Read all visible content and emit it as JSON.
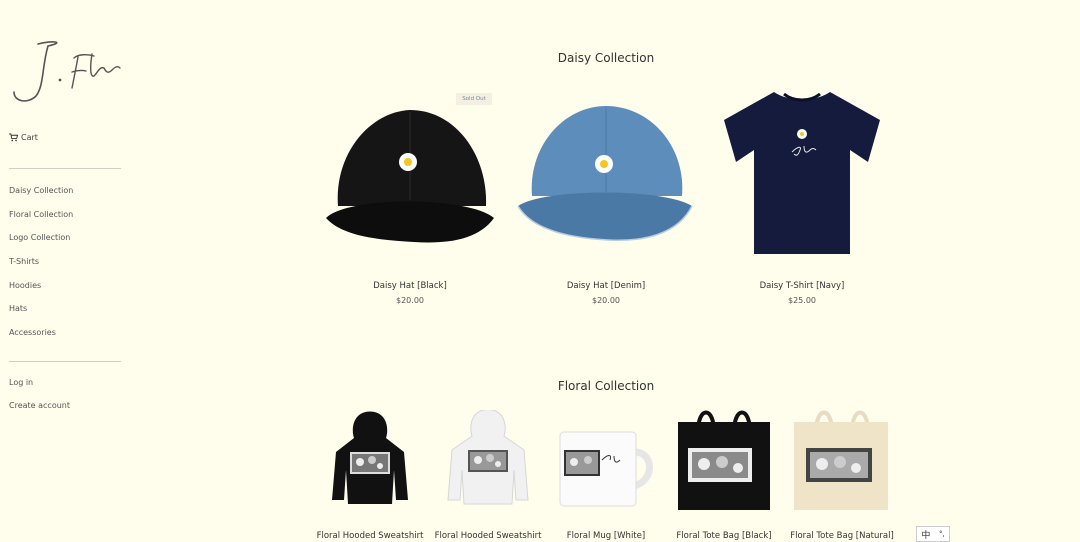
{
  "brand": {
    "logo_text": "J.Flo"
  },
  "sidebar": {
    "cart_label": "Cart",
    "collections": [
      "Daisy Collection",
      "Floral Collection",
      "Logo Collection",
      "T-Shirts",
      "Hoodies",
      "Hats",
      "Accessories"
    ],
    "account": [
      "Log in",
      "Create account"
    ]
  },
  "sections": [
    {
      "title": "Daisy Collection",
      "products": [
        {
          "name": "Daisy Hat [Black]",
          "price": "$20.00",
          "badge": "Sold Out"
        },
        {
          "name": "Daisy Hat [Denim]",
          "price": "$20.00"
        },
        {
          "name": "Daisy T-Shirt [Navy]",
          "price": "$25.00"
        }
      ]
    },
    {
      "title": "Floral Collection",
      "products": [
        {
          "name": "Floral Hooded Sweatshirt"
        },
        {
          "name": "Floral Hooded Sweatshirt"
        },
        {
          "name": "Floral Mug [White]"
        },
        {
          "name": "Floral Tote Bag [Black]"
        },
        {
          "name": "Floral Tote Bag [Natural]"
        }
      ]
    }
  ],
  "ime": {
    "lang": "中",
    "mode": "°,"
  },
  "colors": {
    "background": "#fffdeb",
    "denim": "#4f83b4",
    "navy": "#141b3c",
    "text": "#333333"
  }
}
